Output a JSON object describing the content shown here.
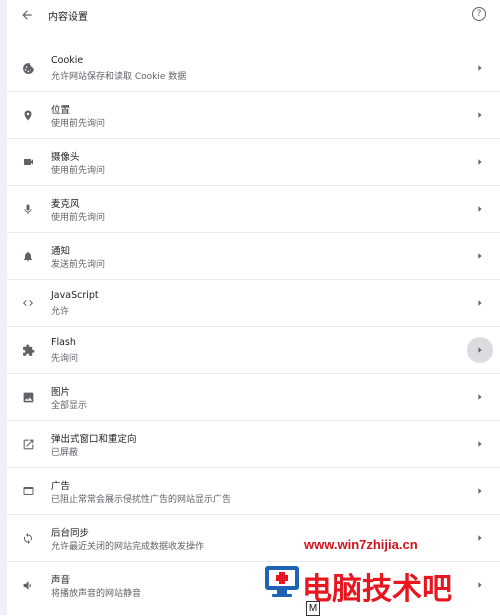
{
  "header": {
    "back_icon": "arrow-left-icon",
    "title": "内容设置",
    "help_icon": "help-circle-icon",
    "help_glyph": "?"
  },
  "settings": [
    {
      "key": "cookie",
      "icon": "cookie-icon",
      "title": "Cookie",
      "subtitle": "允许网站保存和读取 Cookie 数据"
    },
    {
      "key": "location",
      "icon": "location-pin-icon",
      "title": "位置",
      "subtitle": "使用前先询问"
    },
    {
      "key": "camera",
      "icon": "camera-icon",
      "title": "摄像头",
      "subtitle": "使用前先询问"
    },
    {
      "key": "microphone",
      "icon": "microphone-icon",
      "title": "麦克风",
      "subtitle": "使用前先询问"
    },
    {
      "key": "notifications",
      "icon": "bell-icon",
      "title": "通知",
      "subtitle": "发送前先询问"
    },
    {
      "key": "javascript",
      "icon": "code-icon",
      "title": "JavaScript",
      "subtitle": "允许"
    },
    {
      "key": "flash",
      "icon": "puzzle-icon",
      "title": "Flash",
      "subtitle": "先询问"
    },
    {
      "key": "images",
      "icon": "image-icon",
      "title": "图片",
      "subtitle": "全部显示"
    },
    {
      "key": "popups",
      "icon": "open-in-new-icon",
      "title": "弹出式窗口和重定向",
      "subtitle": "已屏蔽"
    },
    {
      "key": "ads",
      "icon": "browser-window-icon",
      "title": "广告",
      "subtitle": "已阻止常常会展示侵扰性广告的网站显示广告"
    },
    {
      "key": "background-sync",
      "icon": "sync-icon",
      "title": "后台同步",
      "subtitle": "允许最近关闭的网站完成数据收发操作"
    },
    {
      "key": "sound",
      "icon": "speaker-icon",
      "title": "声音",
      "subtitle": "将播放声音的网站静音"
    }
  ],
  "hovered_row": "flash",
  "watermark": {
    "url": "www.win7zhijia.cn",
    "brand": "电脑技术吧",
    "badge": "M"
  },
  "colors": {
    "icon": "#5f6368",
    "title": "#202124",
    "subtitle": "#5f6368",
    "divider": "#e8eaed",
    "watermark_red": "#d1121c"
  }
}
